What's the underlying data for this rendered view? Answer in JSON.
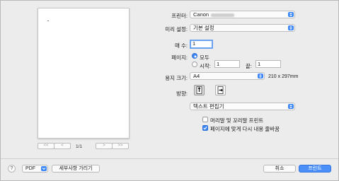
{
  "preview": {
    "page_indicator": "1/1",
    "first_label": "<<",
    "prev_label": "<",
    "next_label": ">",
    "last_label": ">>"
  },
  "printer": {
    "label": "프린터:",
    "value": "Canon"
  },
  "presets": {
    "label": "미리 설정:",
    "value": "기본 설정"
  },
  "copies": {
    "label": "매 수:",
    "value": "1"
  },
  "pages": {
    "label": "페이지:",
    "all_label": "모두",
    "from_label": "시작:",
    "from_value": "1",
    "to_label": "끝:",
    "to_value": "1"
  },
  "paper_size": {
    "label": "용지 크기:",
    "value": "A4",
    "dimensions": "210 x 297mm"
  },
  "orientation": {
    "label": "방향:"
  },
  "section": {
    "value": "텍스트 편집기"
  },
  "options": {
    "header_footer": {
      "label": "머리말 및 꼬리말 프린트",
      "checked": false
    },
    "rewrap": {
      "label": "페이지에 맞게 다시 내용 줄바꿈",
      "checked": true
    }
  },
  "footer": {
    "help": "?",
    "pdf": "PDF",
    "hide_details": "세부사항 가리기",
    "cancel": "취소",
    "print": "프린트"
  },
  "colors": {
    "accent": "#3b86f7",
    "dialog_bg": "#ececec"
  }
}
